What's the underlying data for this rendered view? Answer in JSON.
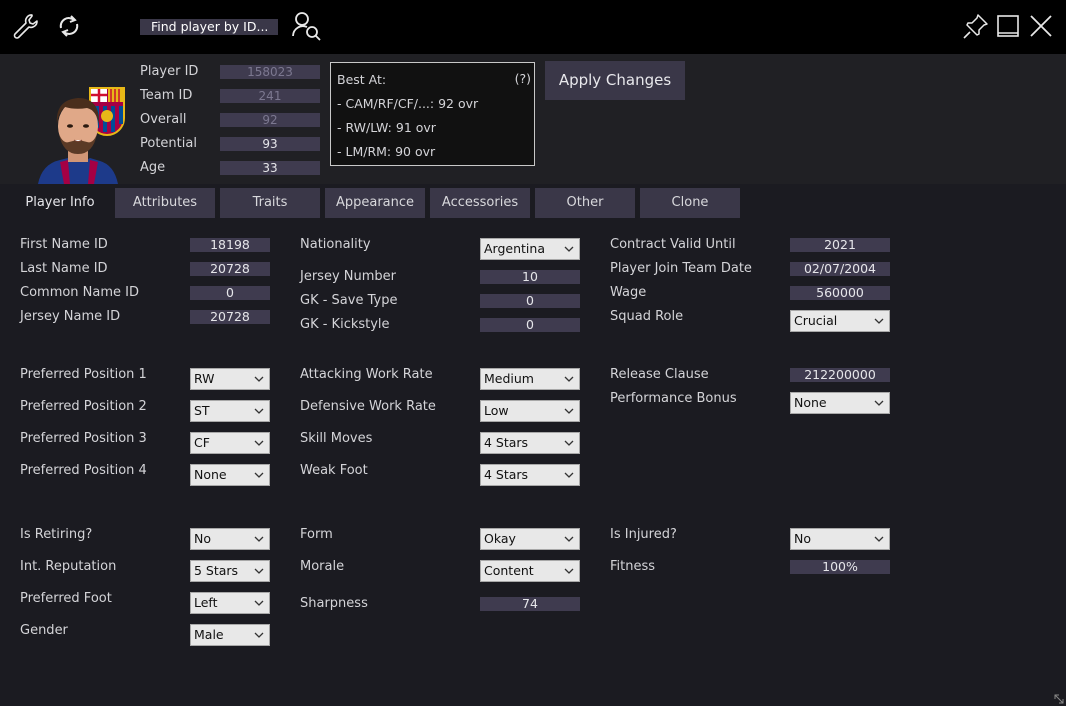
{
  "toolbar": {
    "find_player_label": "Find player by ID...",
    "icons": [
      "wrench-icon",
      "refresh-icon",
      "user-search-icon",
      "pin-icon",
      "maximize-icon",
      "close-icon"
    ]
  },
  "player_header": {
    "player_id_label": "Player ID",
    "player_id": "158023",
    "team_id_label": "Team ID",
    "team_id": "241",
    "overall_label": "Overall",
    "overall": "92",
    "potential_label": "Potential",
    "potential": "93",
    "age_label": "Age",
    "age": "33"
  },
  "best_at": {
    "title": "Best At:",
    "help": "(?)",
    "lines": [
      "- CAM/RF/CF/...: 92 ovr",
      "- RW/LW: 91 ovr",
      "- LM/RM: 90 ovr"
    ]
  },
  "apply_changes_label": "Apply Changes",
  "tabs": [
    "Player Info",
    "Attributes",
    "Traits",
    "Appearance",
    "Accessories",
    "Other",
    "Clone"
  ],
  "form": {
    "first_name_id": {
      "label": "First Name ID",
      "value": "18198"
    },
    "last_name_id": {
      "label": "Last Name ID",
      "value": "20728"
    },
    "common_name_id": {
      "label": "Common Name ID",
      "value": "0"
    },
    "jersey_name_id": {
      "label": "Jersey Name ID",
      "value": "20728"
    },
    "nationality": {
      "label": "Nationality",
      "value": "Argentina"
    },
    "jersey_number": {
      "label": "Jersey Number",
      "value": "10"
    },
    "gk_save_type": {
      "label": "GK - Save Type",
      "value": "0"
    },
    "gk_kickstyle": {
      "label": "GK - Kickstyle",
      "value": "0"
    },
    "contract_valid_until": {
      "label": "Contract Valid Until",
      "value": "2021"
    },
    "player_join_team_date": {
      "label": "Player Join Team Date",
      "value": "02/07/2004"
    },
    "wage": {
      "label": "Wage",
      "value": "560000"
    },
    "squad_role": {
      "label": "Squad Role",
      "value": "Crucial"
    },
    "preferred_position_1": {
      "label": "Preferred Position 1",
      "value": "RW"
    },
    "preferred_position_2": {
      "label": "Preferred Position 2",
      "value": "ST"
    },
    "preferred_position_3": {
      "label": "Preferred Position 3",
      "value": "CF"
    },
    "preferred_position_4": {
      "label": "Preferred Position 4",
      "value": "None"
    },
    "attacking_work_rate": {
      "label": "Attacking Work Rate",
      "value": "Medium"
    },
    "defensive_work_rate": {
      "label": "Defensive Work Rate",
      "value": "Low"
    },
    "skill_moves": {
      "label": "Skill Moves",
      "value": "4 Stars"
    },
    "weak_foot": {
      "label": "Weak Foot",
      "value": "4 Stars"
    },
    "release_clause": {
      "label": "Release Clause",
      "value": "212200000"
    },
    "performance_bonus": {
      "label": "Performance Bonus",
      "value": "None"
    },
    "is_retiring": {
      "label": "Is Retiring?",
      "value": "No"
    },
    "int_reputation": {
      "label": "Int. Reputation",
      "value": "5 Stars"
    },
    "preferred_foot": {
      "label": "Preferred Foot",
      "value": "Left"
    },
    "gender": {
      "label": "Gender",
      "value": "Male"
    },
    "form": {
      "label": "Form",
      "value": "Okay"
    },
    "morale": {
      "label": "Morale",
      "value": "Content"
    },
    "sharpness": {
      "label": "Sharpness",
      "value": "74"
    },
    "is_injured": {
      "label": "Is Injured?",
      "value": "No"
    },
    "fitness": {
      "label": "Fitness",
      "value": "100%"
    }
  }
}
